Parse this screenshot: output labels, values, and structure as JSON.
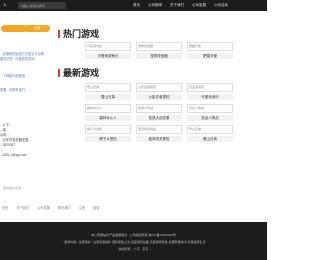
{
  "header": {
    "logo": "人.",
    "search_placeholder": "请输入搜索关键词",
    "nav": [
      "首页",
      "公司新闻",
      "关于我们",
      "公司发展",
      "公司活动"
    ]
  },
  "left": {
    "buttons": [
      "",
      "注册"
    ],
    "notice": [
      "...合格网的运营方式建议平台和",
      "服务请您...仔细查找游戏",
      "...下网络作品使用...",
      "需要...请联系我们..."
    ],
    "info": [
      "...以下...",
      "...单...",
      "公司...",
      "...元年开发机器发展...",
      "...0620287",
      "...",
      "...0421-4@qq.com"
    ]
  },
  "hot": {
    "title": "热门游戏",
    "cards": [
      {
        "thumb": "可爱海滨鱼",
        "name": "可爱海滨鱼乐"
      },
      {
        "thumb": "宠物改造器",
        "name": "宠物改造器"
      },
      {
        "thumb": "肥猫天使",
        "name": "肥猫天使"
      }
    ]
  },
  "newest": {
    "title": "最新游戏",
    "cards": [
      {
        "thumb": "雪山兄弟",
        "name": "雪山兄弟"
      },
      {
        "thumb": "火影忍者冒险",
        "name": "火影忍者冒险"
      },
      {
        "thumb": "可爱消消乐",
        "name": "可爱消消乐"
      },
      {
        "thumb": "森林冰火人",
        "name": "森林冰火人"
      },
      {
        "thumb": "松鼠大作战",
        "name": "松鼠大战坚果"
      },
      {
        "thumb": "张龙人物战",
        "name": "张龙人物战"
      },
      {
        "thumb": "橘子大冒险",
        "name": "橘子大冒险"
      },
      {
        "thumb": "旋风闯关挑战",
        "name": "旋风闯关冒险"
      },
      {
        "thumb": "雪山兄弟",
        "name": "雪山兄弟"
      }
    ]
  },
  "credit": "网站信息来源...",
  "footer": {
    "links": [
      "首页",
      "关于我们",
      "公司发展",
      "联系我们",
      "注册",
      "登录"
    ],
    "lines": [
      "本公司网站均产品保留相关...公司版权所有 陕ICP备09000000号",
      "...游戏内容...注意保护...注意自我保护 谨防受骗上当 适度游戏益脑 沉迷游戏伤身 合理安排时间 享受健康生活",
      "...版权所有... 广东...京东..."
    ]
  }
}
